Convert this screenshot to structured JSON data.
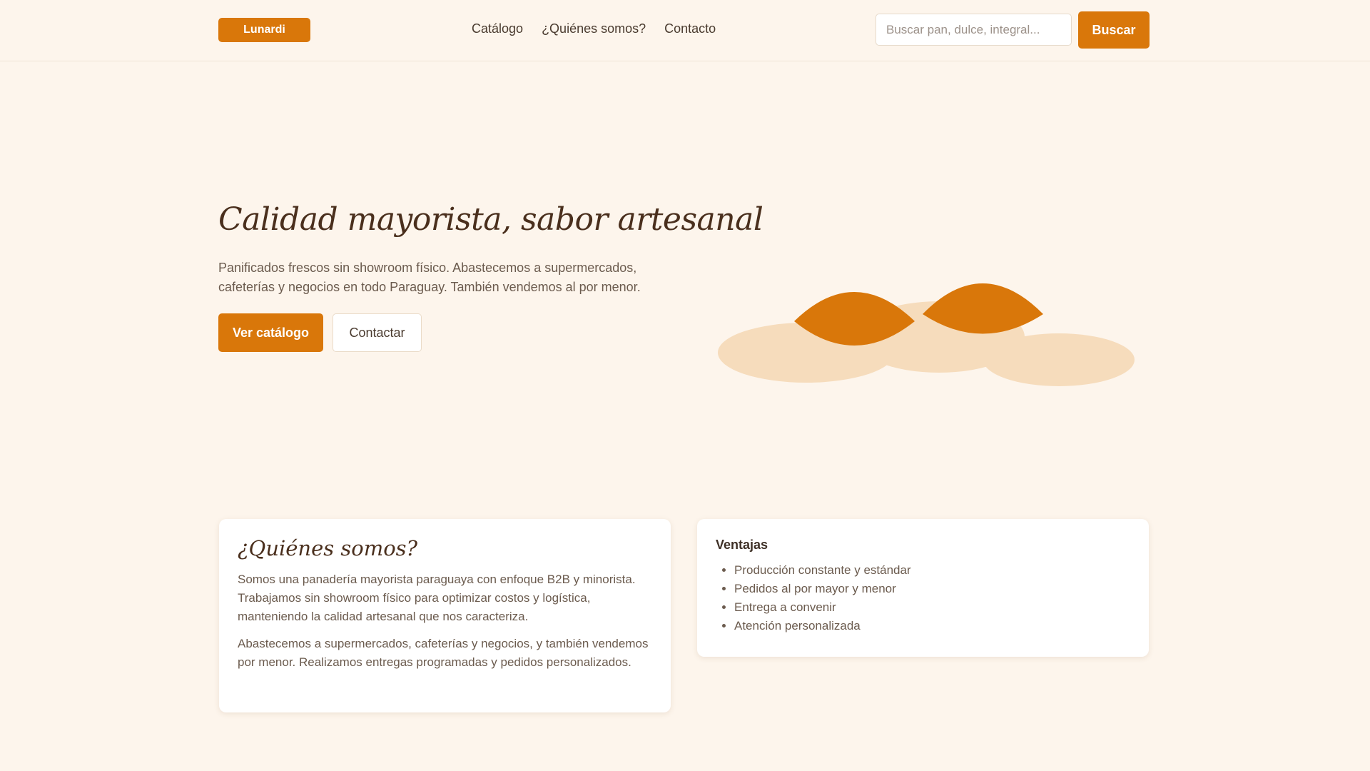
{
  "header": {
    "logo": "Lunardi",
    "nav": [
      "Catálogo",
      "¿Quiénes somos?",
      "Contacto"
    ],
    "search_placeholder": "Buscar pan, dulce, integral...",
    "search_button": "Buscar"
  },
  "hero": {
    "title": "Calidad mayorista, sabor artesanal",
    "text": "Panificados frescos sin showroom físico. Abastecemos a supermercados, cafeterías y negocios en todo Paraguay. También vendemos al por menor.",
    "primary_button": "Ver catálogo",
    "secondary_button": "Contactar"
  },
  "about": {
    "title": "¿Quiénes somos?",
    "paragraphs": [
      "Somos una panadería mayorista paraguaya con enfoque B2B y minorista. Trabajamos sin showroom físico para optimizar costos y logística, manteniendo la calidad artesanal que nos caracteriza.",
      "Abastecemos a supermercados, cafeterías y negocios, y también vendemos por menor. Realizamos entregas programadas y pedidos personalizados."
    ]
  },
  "advantages": {
    "title": "Ventajas",
    "items": [
      "Producción constante y estándar",
      "Pedidos al por mayor y menor",
      "Entrega a convenir",
      "Atención personalizada"
    ]
  },
  "colors": {
    "accent": "#d9770a",
    "background": "#fdf5ec",
    "bread_light": "#f6dcbc",
    "title_brown": "#4a2f1d"
  }
}
